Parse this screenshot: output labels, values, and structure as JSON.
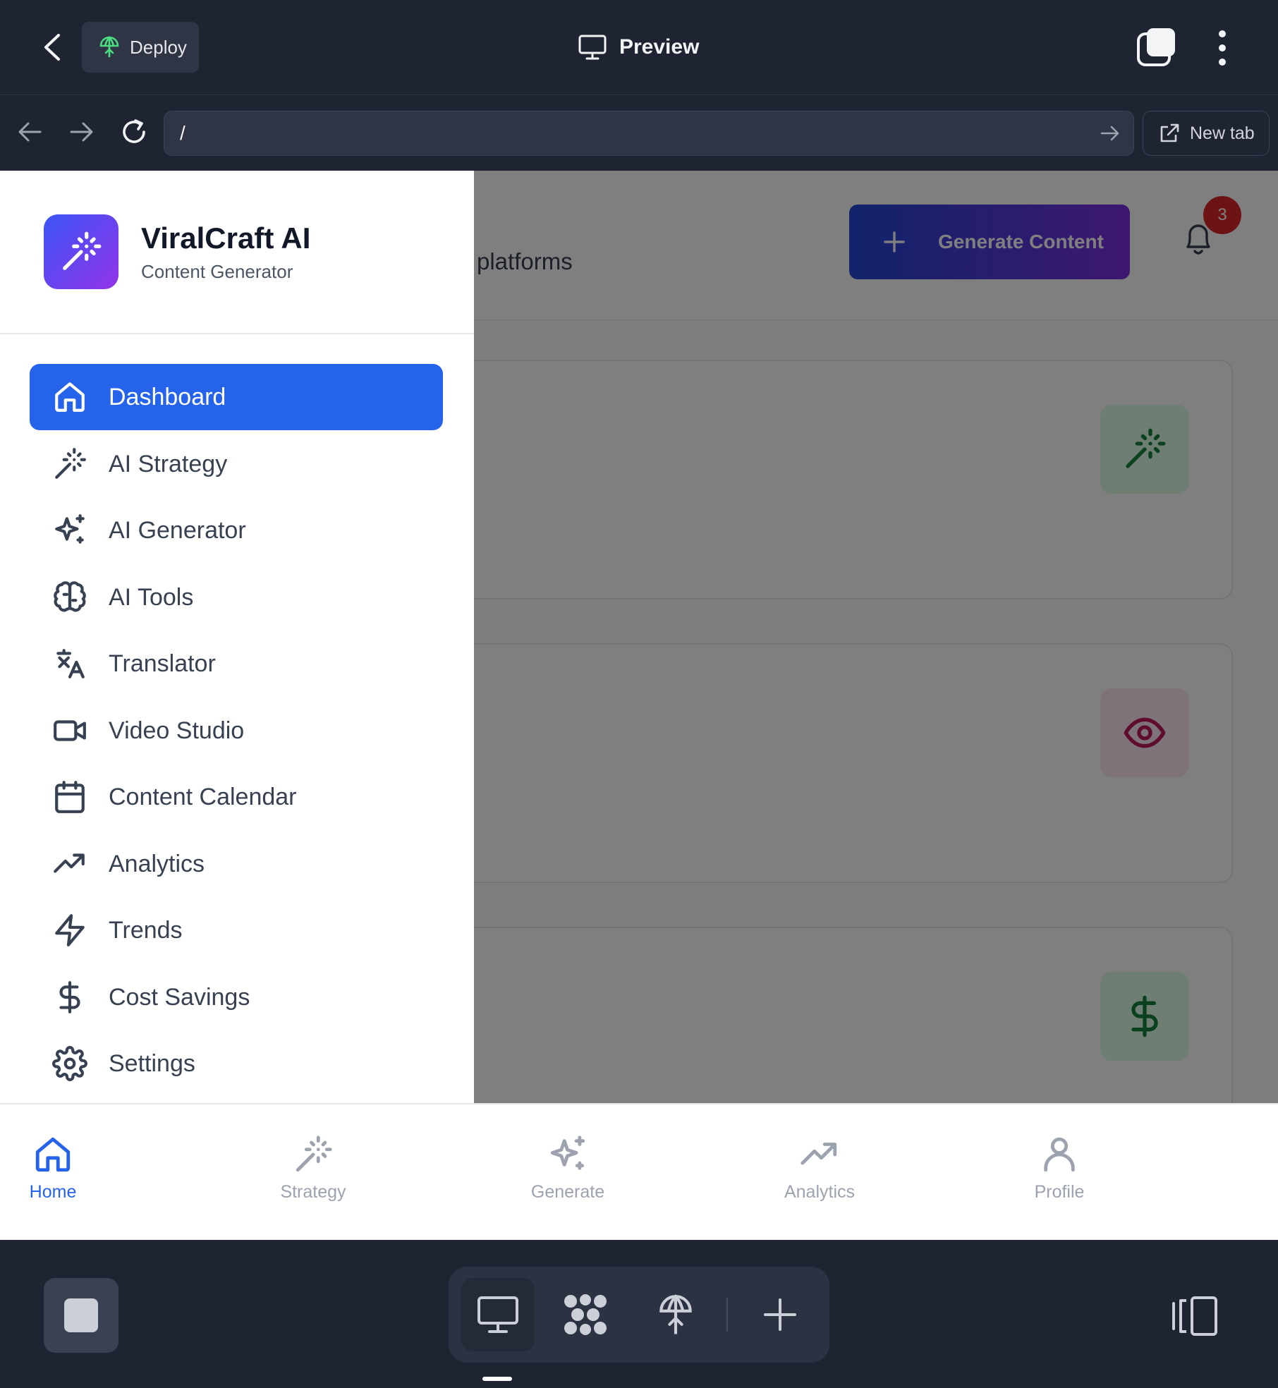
{
  "topbar": {
    "deploy_label": "Deploy",
    "preview_title": "Preview"
  },
  "browser": {
    "url_value": "/",
    "new_tab_label": "New tab"
  },
  "app": {
    "subtitle_fragment": "platforms",
    "generate_button": "Generate Content",
    "notification_count": "3",
    "stat_cards": [
      {
        "icon": "magic-wand-icon",
        "color": "#15803d"
      },
      {
        "icon": "eye-icon",
        "color": "#be185d"
      },
      {
        "icon": "dollar-icon",
        "color": "#15803d"
      }
    ]
  },
  "sidebar": {
    "brand_name": "ViralCraft AI",
    "brand_tagline": "Content Generator",
    "items": [
      {
        "label": "Dashboard",
        "icon": "home-icon",
        "active": true
      },
      {
        "label": "AI Strategy",
        "icon": "magic-wand-icon"
      },
      {
        "label": "AI Generator",
        "icon": "sparkles-icon"
      },
      {
        "label": "AI Tools",
        "icon": "brain-icon"
      },
      {
        "label": "Translator",
        "icon": "translate-icon"
      },
      {
        "label": "Video Studio",
        "icon": "video-icon"
      },
      {
        "label": "Content Calendar",
        "icon": "calendar-icon"
      },
      {
        "label": "Analytics",
        "icon": "trending-up-icon"
      },
      {
        "label": "Trends",
        "icon": "lightning-icon"
      },
      {
        "label": "Cost Savings",
        "icon": "dollar-icon"
      },
      {
        "label": "Settings",
        "icon": "gear-icon"
      }
    ]
  },
  "tabbar": {
    "tabs": [
      {
        "label": "Home",
        "icon": "home-icon",
        "active": true
      },
      {
        "label": "Strategy",
        "icon": "magic-wand-icon"
      },
      {
        "label": "Generate",
        "icon": "sparkles-icon"
      },
      {
        "label": "Analytics",
        "icon": "trending-up-icon"
      },
      {
        "label": "Profile",
        "icon": "user-icon"
      }
    ]
  },
  "colors": {
    "accent": "#2563eb",
    "topbar_bg": "#1f2433",
    "gradient_start": "#2347d8",
    "gradient_end": "#7b2fe0",
    "badge": "#dc2626"
  }
}
